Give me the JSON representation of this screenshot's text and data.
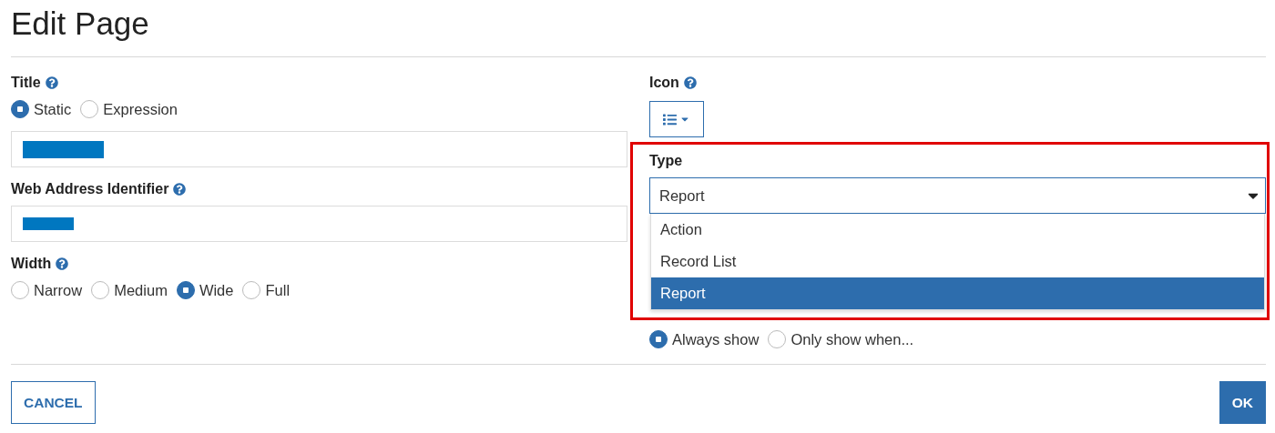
{
  "title": "Edit Page",
  "title_setting": {
    "label": "Title",
    "modes": [
      {
        "label": "Static",
        "selected": true
      },
      {
        "label": "Expression",
        "selected": false
      }
    ]
  },
  "web_address": {
    "label": "Web Address Identifier"
  },
  "width": {
    "label": "Width",
    "options": [
      {
        "label": "Narrow",
        "selected": false
      },
      {
        "label": "Medium",
        "selected": false
      },
      {
        "label": "Wide",
        "selected": true
      },
      {
        "label": "Full",
        "selected": false
      }
    ]
  },
  "icon": {
    "label": "Icon"
  },
  "type": {
    "label": "Type",
    "value": "Report",
    "expanded": true,
    "options": [
      {
        "label": "Action",
        "selected": false
      },
      {
        "label": "Record List",
        "selected": false
      },
      {
        "label": "Report",
        "selected": true
      }
    ]
  },
  "visibility": {
    "options": [
      {
        "label": "Always show",
        "selected": true
      },
      {
        "label": "Only show when...",
        "selected": false
      }
    ]
  },
  "buttons": [
    {
      "label": "CANCEL",
      "kind": "secondary"
    },
    {
      "label": "OK",
      "kind": "primary"
    }
  ]
}
